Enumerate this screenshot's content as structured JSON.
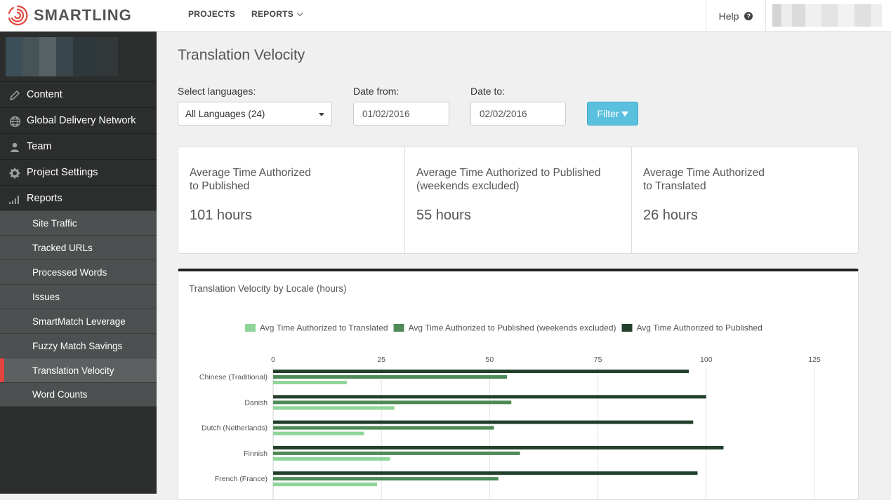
{
  "app": {
    "brand": "SMARTLING"
  },
  "topnav": {
    "projects": "PROJECTS",
    "reports": "REPORTS",
    "help": "Help",
    "help_icon": "?"
  },
  "sidebar": {
    "main_items": [
      {
        "label": "Content",
        "icon": "pencil-icon"
      },
      {
        "label": "Global Delivery Network",
        "icon": "globe-icon"
      },
      {
        "label": "Team",
        "icon": "user-icon"
      },
      {
        "label": "Project Settings",
        "icon": "gear-icon"
      },
      {
        "label": "Reports",
        "icon": "signal-bars-icon"
      }
    ],
    "report_items": [
      {
        "label": "Site Traffic"
      },
      {
        "label": "Tracked URLs"
      },
      {
        "label": "Processed Words"
      },
      {
        "label": "Issues"
      },
      {
        "label": "SmartMatch Leverage"
      },
      {
        "label": "Fuzzy Match Savings"
      },
      {
        "label": "Translation Velocity",
        "active": true
      },
      {
        "label": "Word Counts"
      }
    ]
  },
  "page": {
    "title": "Translation Velocity",
    "filters": {
      "languages_label": "Select languages:",
      "languages_value": "All Languages (24)",
      "date_from_label": "Date from:",
      "date_from_value": "01/02/2016",
      "date_to_label": "Date to:",
      "date_to_value": "02/02/2016",
      "filter_button": "Filter"
    },
    "stats": [
      {
        "title": "Average Time Authorized\nto Published",
        "value": "101 hours"
      },
      {
        "title": "Average Time Authorized to Published\n(weekends excluded)",
        "value": "55 hours"
      },
      {
        "title": "Average Time Authorized\nto Translated",
        "value": "26 hours"
      }
    ],
    "chart_title": "Translation Velocity by Locale (hours)"
  },
  "colors": {
    "translated": "#8fd59a",
    "published_wx": "#4e8a55",
    "published": "#23402a",
    "accent_active": "#e2463f",
    "filter_button": "#5bc0de"
  },
  "chart_data": {
    "type": "bar",
    "orientation": "horizontal",
    "title": "Translation Velocity by Locale (hours)",
    "xlim": [
      0,
      125
    ],
    "xticks": [
      0,
      25,
      50,
      75,
      100,
      125
    ],
    "legend_position": "top",
    "grid": true,
    "categories": [
      "Chinese (Traditional)",
      "Danish",
      "Dutch (Netherlands)",
      "Finnish",
      "French (France)"
    ],
    "series": [
      {
        "name": "Avg Time Authorized to Published",
        "color": "#23402a",
        "values": [
          96,
          100,
          97,
          104,
          98
        ]
      },
      {
        "name": "Avg Time Authorized to Published (weekends excluded)",
        "color": "#4e8a55",
        "values": [
          54,
          55,
          51,
          57,
          52
        ]
      },
      {
        "name": "Avg Time Authorized to Translated",
        "color": "#8fd59a",
        "values": [
          17,
          28,
          21,
          27,
          24
        ]
      }
    ],
    "legend_order": [
      "Avg Time Authorized to Translated",
      "Avg Time Authorized to Published (weekends excluded)",
      "Avg Time Authorized to Published"
    ]
  }
}
